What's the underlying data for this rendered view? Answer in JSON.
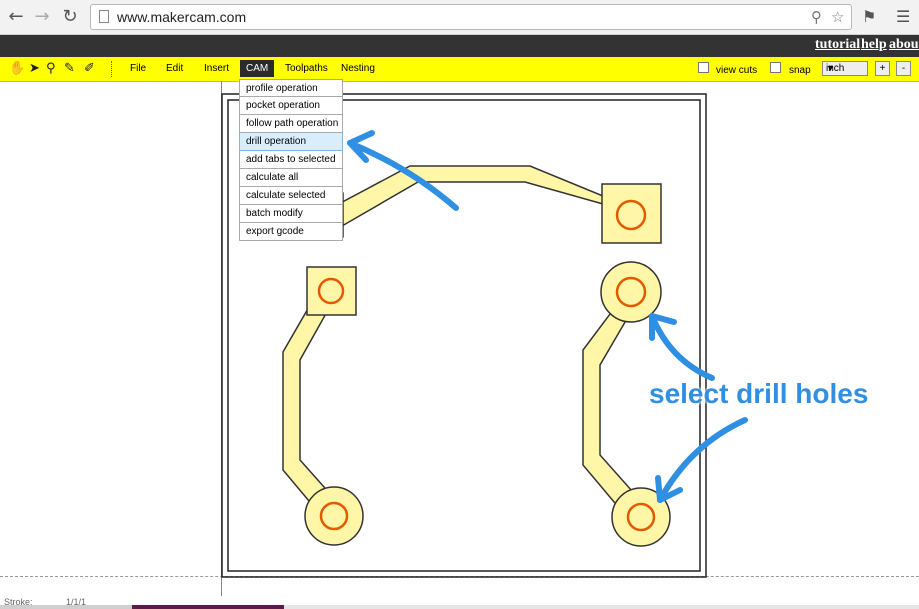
{
  "browser": {
    "url": "www.makercam.com"
  },
  "top_links": [
    "tutorial",
    "help",
    "about"
  ],
  "menubar": {
    "items": [
      "File",
      "Edit",
      "Insert",
      "CAM",
      "Toolpaths",
      "Nesting"
    ],
    "active": "CAM"
  },
  "toolbar_right": {
    "view_cuts_label": "view cuts",
    "snap_label": "snap",
    "unit_value": "inch",
    "plus_label": "+",
    "minus_label": "-"
  },
  "cam_menu": [
    "profile operation",
    "pocket operation",
    "follow path operation",
    "drill operation",
    "add tabs to selected",
    "calculate all",
    "calculate selected",
    "batch modify",
    "export gcode"
  ],
  "cam_menu_highlighted": "drill operation",
  "annotation": {
    "text": "select drill holes",
    "color": "#2f8fe3"
  },
  "status": {
    "stroke_label": "Stroke:",
    "stroke_value": "1/1/1"
  },
  "colors": {
    "toolbar": "#ffff00",
    "trace_fill": "#fff6a8",
    "hole_ring": "#e45a00",
    "arrow": "#2f8fe3",
    "top_bar": "#333333"
  }
}
